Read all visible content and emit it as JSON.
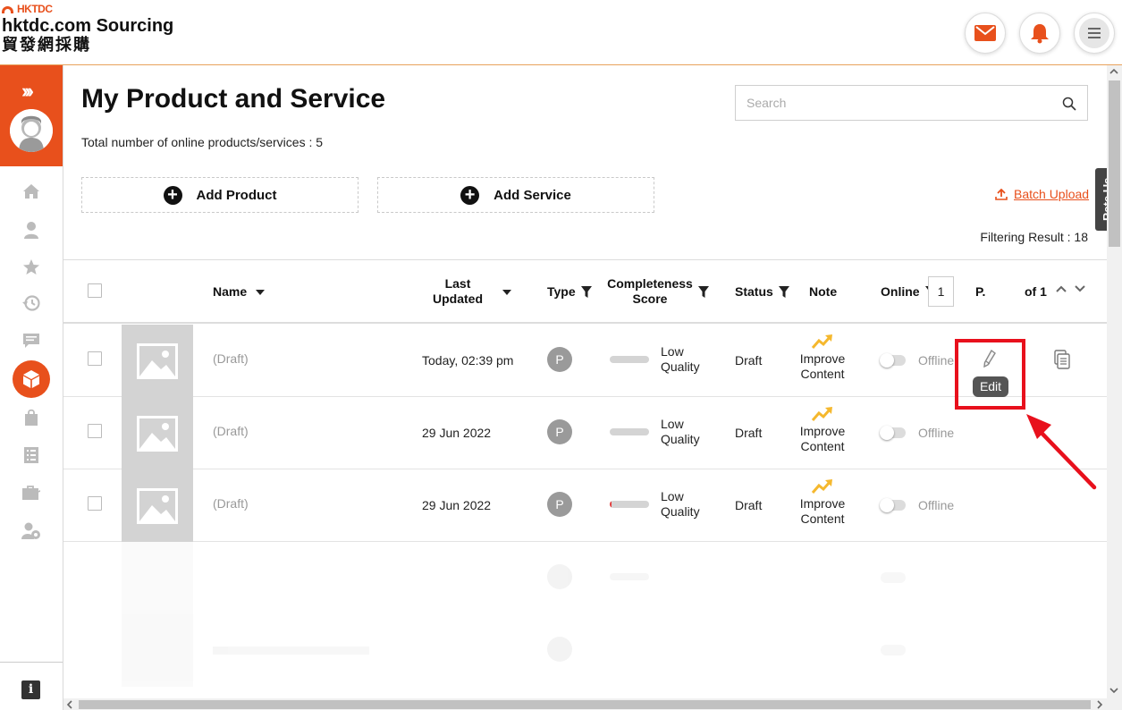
{
  "header": {
    "logo_small": "HKTDC",
    "logo_main": "hktdc.com Sourcing",
    "logo_sub": "貿發網採購"
  },
  "sidebar": {
    "expand_icon": "double-chevron-right-icon",
    "items": [
      "home-icon",
      "user-icon",
      "star-icon",
      "history-icon",
      "message-icon",
      "product-box-icon",
      "bag-icon",
      "checklist-icon",
      "briefcase-icon",
      "user-settings-icon"
    ],
    "info_label": "i"
  },
  "main": {
    "title": "My Product and Service",
    "total_text": "Total number of online products/services : 5",
    "search_placeholder": "Search",
    "add_product_label": "Add Product",
    "add_service_label": "Add Service",
    "batch_upload_label": "Batch Upload",
    "filtering_result": "Filtering Result : 18",
    "rate_us_label": "Rate Us"
  },
  "table": {
    "headers": {
      "name": "Name",
      "last_updated": "Last Updated",
      "type": "Type",
      "completeness": "Completeness Score",
      "status": "Status",
      "note": "Note",
      "online": "Online",
      "page_prefix": "P.",
      "page_value": "1",
      "page_suffix": "of 1"
    },
    "rows": [
      {
        "name": "(Draft)",
        "updated": "Today, 02:39 pm",
        "type": "P",
        "score_fraction": 0.0,
        "quality": "Low Quality",
        "status": "Draft",
        "note": "Improve Content",
        "online": "Offline"
      },
      {
        "name": "(Draft)",
        "updated": "29 Jun 2022",
        "type": "P",
        "score_fraction": 0.0,
        "quality": "Low Quality",
        "status": "Draft",
        "note": "Improve Content",
        "online": "Offline"
      },
      {
        "name": "(Draft)",
        "updated": "29 Jun 2022",
        "type": "P",
        "score_fraction": 0.05,
        "quality": "Low Quality",
        "status": "Draft",
        "note": "Improve Content",
        "online": "Offline"
      }
    ],
    "edit_tooltip": "Edit"
  },
  "colors": {
    "brand": "#e8501c",
    "highlight": "#e8101c",
    "trend": "#f5b82e"
  }
}
